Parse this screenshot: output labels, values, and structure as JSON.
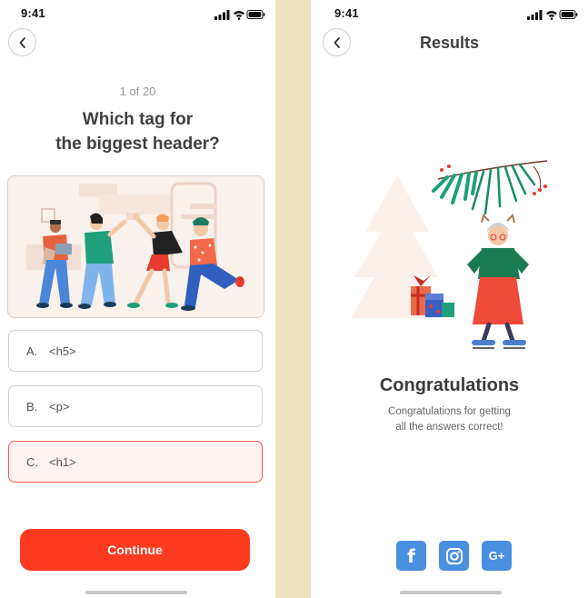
{
  "status_bar": {
    "time_left": "9:41",
    "time_right": "9:41"
  },
  "quiz": {
    "progress": "1 of 20",
    "question_line1": "Which tag for",
    "question_line2": "the biggest header?",
    "options": [
      {
        "key": "A.",
        "value": "<h5>",
        "selected": false
      },
      {
        "key": "B.",
        "value": "<p>",
        "selected": false
      },
      {
        "key": "C.",
        "value": "<h1>",
        "selected": true
      }
    ],
    "continue_label": "Continue"
  },
  "results": {
    "title": "Results",
    "heading": "Congratulations",
    "message_line1": "Congratulations for getting",
    "message_line2": "all the answers correct!",
    "social": [
      {
        "name": "facebook-icon",
        "glyph": "f"
      },
      {
        "name": "instagram-icon",
        "glyph": ""
      },
      {
        "name": "google-plus-icon",
        "glyph": "G+"
      }
    ]
  },
  "colors": {
    "accent": "#ff3b1f",
    "selected_border": "#ff5a4c",
    "selected_bg": "#fff3ef",
    "divider": "#ece4bf",
    "social_blue": "#4a8fe0"
  }
}
